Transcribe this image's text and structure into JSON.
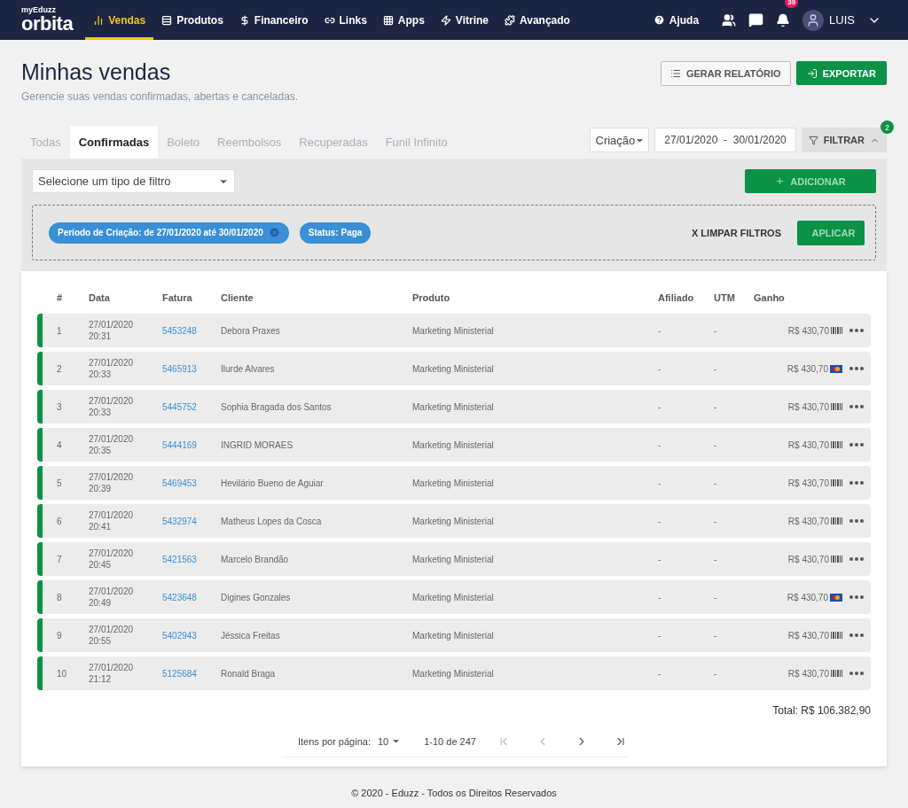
{
  "topbar": {
    "logo_small": "myEduzz",
    "logo": "orbita",
    "nav": [
      {
        "label": "Vendas",
        "selected": true
      },
      {
        "label": "Produtos",
        "selected": false
      },
      {
        "label": "Financeiro",
        "selected": false
      },
      {
        "label": "Links",
        "selected": false
      },
      {
        "label": "Apps",
        "selected": false
      },
      {
        "label": "Vitrine",
        "selected": false
      },
      {
        "label": "Avançado",
        "selected": false
      }
    ],
    "help": "Ajuda",
    "notifications": "39",
    "user": "LUIS"
  },
  "header": {
    "title": "Minhas vendas",
    "subtitle": "Gerencie suas vendas confirmadas, abertas e canceladas.",
    "report_button": "GERAR RELATÓRIO",
    "export_button": "EXPORTAR"
  },
  "tabs": [
    {
      "label": "Todas",
      "selected": false
    },
    {
      "label": "Confirmadas",
      "selected": true
    },
    {
      "label": "Boleto",
      "selected": false
    },
    {
      "label": "Reembolsos",
      "selected": false
    },
    {
      "label": "Recuperadas",
      "selected": false
    },
    {
      "label": "Funil Infinito",
      "selected": false
    }
  ],
  "date_type": "Criação",
  "date_range": "27/01/2020  -  30/01/2020",
  "filter_button": "FILTRAR",
  "filter_count": "2",
  "filter_panel": {
    "select_placeholder": "Selecione um tipo de filtro",
    "add_button": "ADICIONAR",
    "add_disabled": true,
    "chips": [
      {
        "label": "Período de Criação: de 27/01/2020 até 30/01/2020",
        "removable": true
      },
      {
        "label": "Status: Paga",
        "removable": false
      }
    ],
    "clear_button": "X LIMPAR FILTROS",
    "apply_button": "APLICAR",
    "apply_disabled": true
  },
  "table": {
    "columns": [
      "#",
      "Data",
      "Fatura",
      "Cliente",
      "Produto",
      "Afiliado",
      "UTM",
      "Ganho"
    ],
    "rows": [
      {
        "n": "1",
        "date": "27/01/2020",
        "time": "20:31",
        "invoice": "5453248",
        "client": "Debora Praxes",
        "product": "Marketing Ministerial",
        "affiliate": "-",
        "utm": "-",
        "amount": "R$ 430,70",
        "kind": "boleto"
      },
      {
        "n": "2",
        "date": "27/01/2020",
        "time": "20:33",
        "invoice": "5465913",
        "client": "Ilurde Alvares",
        "product": "Marketing Ministerial",
        "affiliate": "-",
        "utm": "-",
        "amount": "R$ 430,70",
        "kind": "card"
      },
      {
        "n": "3",
        "date": "27/01/2020",
        "time": "20:33",
        "invoice": "5445752",
        "client": "Sophia Bragada dos Santos",
        "product": "Marketing Ministerial",
        "affiliate": "-",
        "utm": "-",
        "amount": "R$ 430,70",
        "kind": "boleto"
      },
      {
        "n": "4",
        "date": "27/01/2020",
        "time": "20:35",
        "invoice": "5444169",
        "client": "INGRID MORAES",
        "product": "Marketing Ministerial",
        "affiliate": "-",
        "utm": "-",
        "amount": "R$ 430,70",
        "kind": "boleto"
      },
      {
        "n": "5",
        "date": "27/01/2020",
        "time": "20:39",
        "invoice": "5469453",
        "client": "Hevilário Bueno de Aguiar",
        "product": "Marketing Ministerial",
        "affiliate": "-",
        "utm": "-",
        "amount": "R$ 430,70",
        "kind": "boleto"
      },
      {
        "n": "6",
        "date": "27/01/2020",
        "time": "20:41",
        "invoice": "5432974",
        "client": "Matheus Lopes da Cosca",
        "product": "Marketing Ministerial",
        "affiliate": "-",
        "utm": "-",
        "amount": "R$ 430,70",
        "kind": "boleto"
      },
      {
        "n": "7",
        "date": "27/01/2020",
        "time": "20:45",
        "invoice": "5421563",
        "client": "Marcelo Brandão",
        "product": "Marketing Ministerial",
        "affiliate": "-",
        "utm": "-",
        "amount": "R$ 430,70",
        "kind": "boleto"
      },
      {
        "n": "8",
        "date": "27/01/2020",
        "time": "20:49",
        "invoice": "5423648",
        "client": "Digines Gonzales",
        "product": "Marketing Ministerial",
        "affiliate": "-",
        "utm": "-",
        "amount": "R$ 430,70",
        "kind": "card"
      },
      {
        "n": "9",
        "date": "27/01/2020",
        "time": "20:55",
        "invoice": "5402943",
        "client": "Jéssica Freitas",
        "product": "Marketing Ministerial",
        "affiliate": "-",
        "utm": "-",
        "amount": "R$ 430,70",
        "kind": "boleto"
      },
      {
        "n": "10",
        "date": "27/01/2020",
        "time": "21:12",
        "invoice": "5125684",
        "client": "Ronald Braga",
        "product": "Marketing Ministerial",
        "affiliate": "-",
        "utm": "-",
        "amount": "R$ 430,70",
        "kind": "boleto"
      }
    ],
    "total": "Total: R$ 106.382,90"
  },
  "pagination": {
    "label": "Itens por página:",
    "page_size": "10",
    "range": "1-10 de 247"
  },
  "footer": "© 2020 - Eduzz - Todos os Direitos Reservados"
}
